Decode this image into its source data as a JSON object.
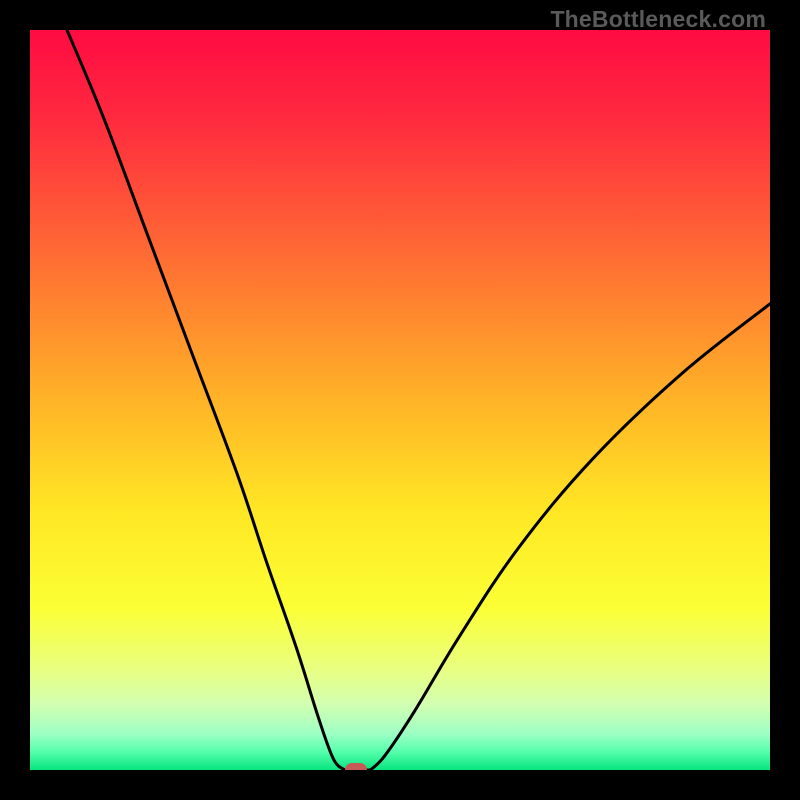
{
  "watermark": {
    "text": "TheBottleneck.com"
  },
  "chart_data": {
    "type": "line",
    "title": "",
    "xlabel": "",
    "ylabel": "",
    "xlim": [
      0,
      100
    ],
    "ylim": [
      0,
      100
    ],
    "grid": false,
    "legend": false,
    "gradient_stops": [
      {
        "pct": 0,
        "color": "#ff0b42"
      },
      {
        "pct": 12,
        "color": "#ff2a3f"
      },
      {
        "pct": 30,
        "color": "#ff6a34"
      },
      {
        "pct": 50,
        "color": "#ffb327"
      },
      {
        "pct": 65,
        "color": "#ffe724"
      },
      {
        "pct": 78,
        "color": "#fbff34"
      },
      {
        "pct": 86,
        "color": "#eaff7d"
      },
      {
        "pct": 91,
        "color": "#d3ffb0"
      },
      {
        "pct": 95,
        "color": "#a0ffc4"
      },
      {
        "pct": 97.5,
        "color": "#57ffad"
      },
      {
        "pct": 100,
        "color": "#07e57e"
      }
    ],
    "series": [
      {
        "name": "left-branch",
        "x": [
          5,
          10,
          16,
          22,
          28,
          32,
          36,
          39,
          41,
          42.5
        ],
        "y": [
          100,
          88,
          72,
          56,
          40,
          28,
          16.5,
          7,
          1.5,
          0
        ]
      },
      {
        "name": "right-branch",
        "x": [
          46,
          48,
          52,
          58,
          66,
          76,
          88,
          100
        ],
        "y": [
          0,
          2,
          8,
          18,
          30,
          42,
          53.5,
          63
        ]
      },
      {
        "name": "floor",
        "x": [
          42.5,
          46
        ],
        "y": [
          0,
          0
        ]
      }
    ],
    "marker": {
      "x": 44,
      "y": 0,
      "color": "#c65a56"
    }
  }
}
